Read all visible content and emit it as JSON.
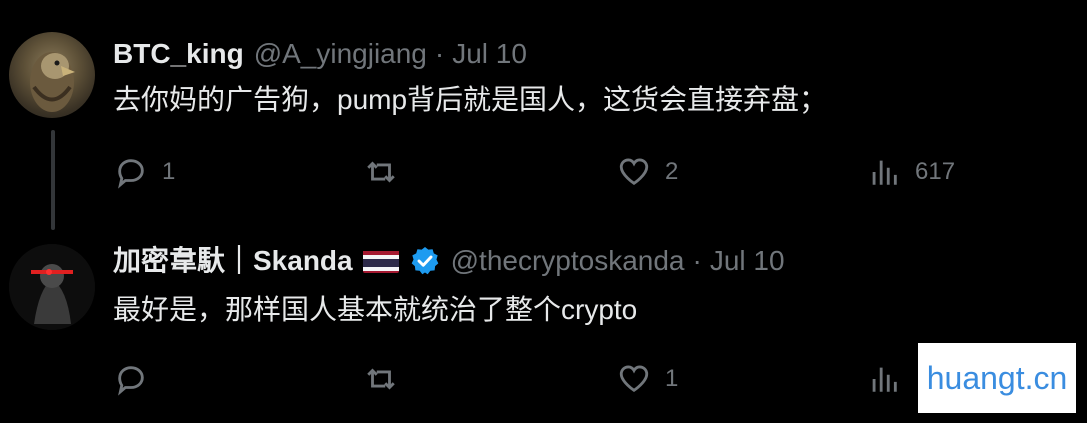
{
  "tweets": [
    {
      "name": "BTC_king",
      "handle": "@A_yingjiang",
      "dot": "·",
      "date": "Jul 10",
      "text": "去你妈的广告狗，pump背后就是国人，这货会直接弃盘；",
      "replies": "1",
      "retweets": "",
      "likes": "2",
      "views": "617"
    },
    {
      "name": "加密韋馱｜Skanda",
      "handle": "@thecryptoskanda",
      "dot": "·",
      "date": "Jul 10",
      "text": "最好是，那样国人基本就统治了整个crypto",
      "replies": "",
      "retweets": "",
      "likes": "1",
      "views": ""
    }
  ],
  "colors": {
    "background": "#000000",
    "text": "#e7e9ea",
    "muted": "#71767b",
    "verified": "#1d9bf0"
  },
  "watermark": {
    "text": "huangt.cn"
  }
}
